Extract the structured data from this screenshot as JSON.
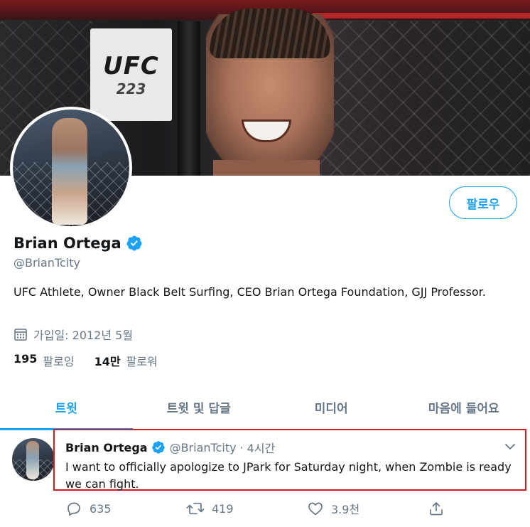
{
  "banner": {
    "sign_text": "UFC",
    "sign_number": "223"
  },
  "profile": {
    "follow_label": "팔로우",
    "name": "Brian Ortega",
    "handle": "@BrianTcity",
    "bio": "UFC Athlete, Owner Black Belt Surfing, CEO Brian Ortega Foundation, GJJ Professor.",
    "joined": "가입일: 2012년 5월",
    "following_count": "195",
    "following_label": "팔로잉",
    "followers_count": "14만",
    "followers_label": "팔로워"
  },
  "tabs": [
    {
      "label": "트윗",
      "active": true
    },
    {
      "label": "트윗 및 답글",
      "active": false
    },
    {
      "label": "미디어",
      "active": false
    },
    {
      "label": "마음에 들어요",
      "active": false
    }
  ],
  "tweet": {
    "name": "Brian Ortega",
    "handle": "@BrianTcity",
    "separator": "·",
    "time": "4시간",
    "text": "I want to officially apologize to JPark for Saturday night, when Zombie is ready we  can fight.",
    "replies": "635",
    "retweets": "419",
    "likes": "3.9천"
  },
  "colors": {
    "accent": "#1da1f2",
    "highlight_border": "#d71920",
    "secondary_text": "#657786"
  },
  "icons": [
    "verified-badge-icon",
    "calendar-icon",
    "chevron-down-icon",
    "reply-icon",
    "retweet-icon",
    "like-icon",
    "share-icon"
  ]
}
